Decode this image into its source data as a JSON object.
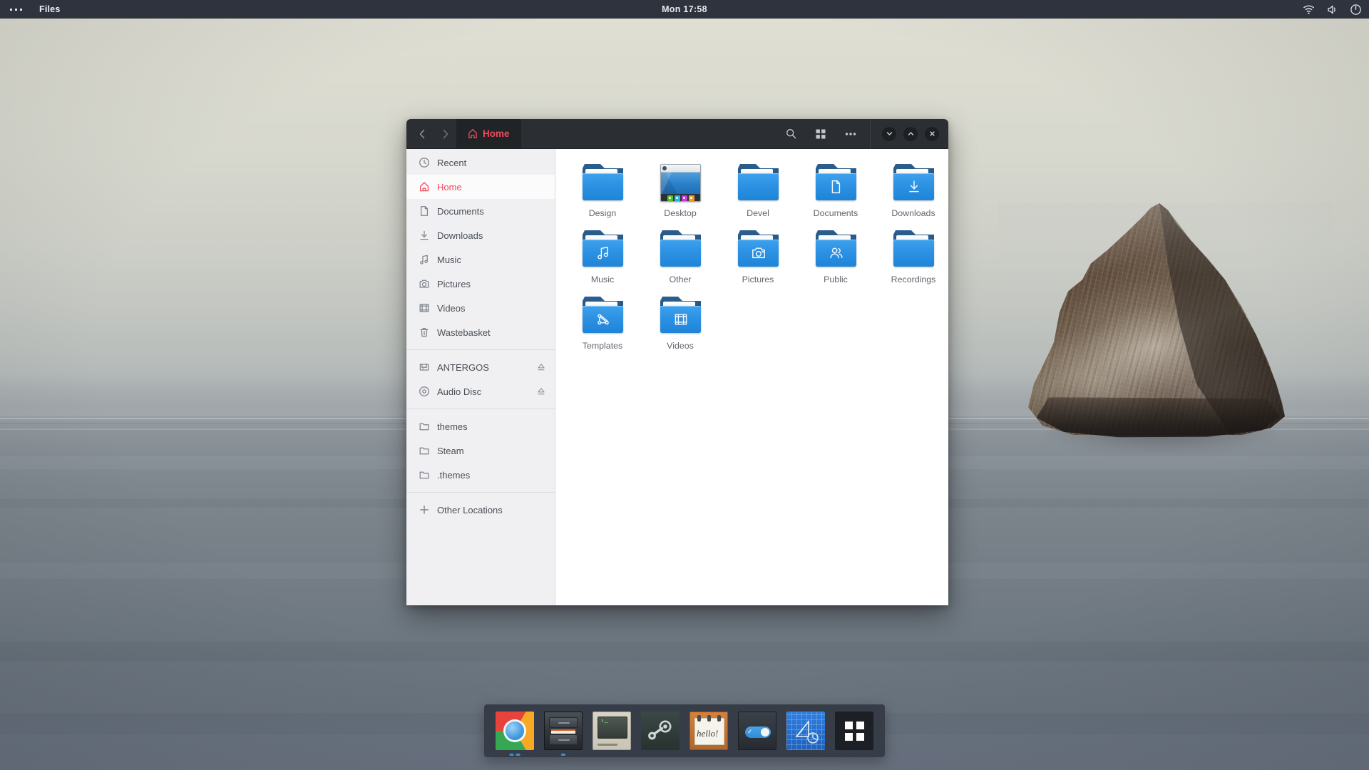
{
  "topbar": {
    "activities_label": "activities-dots",
    "app_name": "Files",
    "clock": "Mon 17:58",
    "indicators": [
      "wifi-icon",
      "volume-icon",
      "power-icon"
    ]
  },
  "window": {
    "title": "Files",
    "nav": {
      "back": "back-arrow",
      "forward": "forward-arrow"
    },
    "path_label": "Home",
    "path_icon": "home-icon",
    "accent_color": "#ef4a5c",
    "tools": [
      {
        "name": "search-button",
        "icon": "search-icon"
      },
      {
        "name": "view-grid-button",
        "icon": "grid-icon"
      },
      {
        "name": "menu-button",
        "icon": "ellipsis-icon"
      }
    ],
    "controls": [
      {
        "name": "minimize-button",
        "icon": "chevron-down-icon"
      },
      {
        "name": "maximize-button",
        "icon": "chevron-up-icon"
      },
      {
        "name": "close-button",
        "icon": "close-icon"
      }
    ]
  },
  "sidebar": {
    "groups": [
      {
        "items": [
          {
            "label": "Recent",
            "icon": "clock-icon",
            "active": false,
            "eject": false
          },
          {
            "label": "Home",
            "icon": "home-icon",
            "active": true,
            "eject": false
          },
          {
            "label": "Documents",
            "icon": "document-icon",
            "active": false,
            "eject": false
          },
          {
            "label": "Downloads",
            "icon": "download-icon",
            "active": false,
            "eject": false
          },
          {
            "label": "Music",
            "icon": "music-note-icon",
            "active": false,
            "eject": false
          },
          {
            "label": "Pictures",
            "icon": "camera-icon",
            "active": false,
            "eject": false
          },
          {
            "label": "Videos",
            "icon": "film-icon",
            "active": false,
            "eject": false
          },
          {
            "label": "Wastebasket",
            "icon": "trash-icon",
            "active": false,
            "eject": false
          }
        ]
      },
      {
        "items": [
          {
            "label": "ANTERGOS",
            "icon": "drive-icon",
            "active": false,
            "eject": true
          },
          {
            "label": "Audio Disc",
            "icon": "disc-icon",
            "active": false,
            "eject": true
          }
        ]
      },
      {
        "items": [
          {
            "label": "themes",
            "icon": "folder-outline-icon",
            "active": false,
            "eject": false
          },
          {
            "label": "Steam",
            "icon": "folder-outline-icon",
            "active": false,
            "eject": false
          },
          {
            "label": ".themes",
            "icon": "folder-outline-icon",
            "active": false,
            "eject": false
          }
        ]
      },
      {
        "items": [
          {
            "label": "Other Locations",
            "icon": "plus-icon",
            "active": false,
            "eject": false
          }
        ]
      }
    ]
  },
  "files": [
    {
      "name": "Design",
      "type": "folder",
      "emblem": "none"
    },
    {
      "name": "Desktop",
      "type": "desktop",
      "emblem": "desktop-preview"
    },
    {
      "name": "Devel",
      "type": "folder",
      "emblem": "none"
    },
    {
      "name": "Documents",
      "type": "folder",
      "emblem": "document-icon"
    },
    {
      "name": "Downloads",
      "type": "folder",
      "emblem": "download-icon"
    },
    {
      "name": "Music",
      "type": "folder",
      "emblem": "music-note-icon"
    },
    {
      "name": "Other",
      "type": "folder",
      "emblem": "none"
    },
    {
      "name": "Pictures",
      "type": "folder",
      "emblem": "camera-icon"
    },
    {
      "name": "Public",
      "type": "folder",
      "emblem": "people-icon"
    },
    {
      "name": "Recordings",
      "type": "folder",
      "emblem": "none"
    },
    {
      "name": "Templates",
      "type": "folder",
      "emblem": "graph-icon"
    },
    {
      "name": "Videos",
      "type": "folder",
      "emblem": "film-icon"
    }
  ],
  "desktop_preview": {
    "dock_colors": [
      "#5bbd2a",
      "#2bb7e0",
      "#c13fd6",
      "#f0992a"
    ]
  },
  "dock": {
    "items": [
      {
        "name": "chrome",
        "label": "Google Chrome",
        "icon": "chrome-icon",
        "running": true,
        "windows": 2
      },
      {
        "name": "files",
        "label": "Files",
        "icon": "cabinet-icon",
        "running": true,
        "windows": 1
      },
      {
        "name": "terminal",
        "label": "Terminal",
        "icon": "terminal-icon",
        "running": false,
        "windows": 0
      },
      {
        "name": "steam",
        "label": "Steam",
        "icon": "steam-icon",
        "running": false,
        "windows": 0
      },
      {
        "name": "notes",
        "label": "Notes",
        "icon": "notepad-icon",
        "running": false,
        "windows": 0
      },
      {
        "name": "settings",
        "label": "Settings",
        "icon": "toggle-icon",
        "running": false,
        "windows": 0
      },
      {
        "name": "blueprint",
        "label": "Blueprint",
        "icon": "blueprint-icon",
        "running": false,
        "windows": 0
      },
      {
        "name": "show-apps",
        "label": "Show Applications",
        "icon": "grid-apps-icon",
        "running": false,
        "windows": 0
      }
    ]
  },
  "wallpaper": {
    "description": "sea-stack-rock-seascape",
    "sky_color": "#dcdcd1",
    "sea_color": "#737c86",
    "rock_color": "#5f4b3c"
  }
}
